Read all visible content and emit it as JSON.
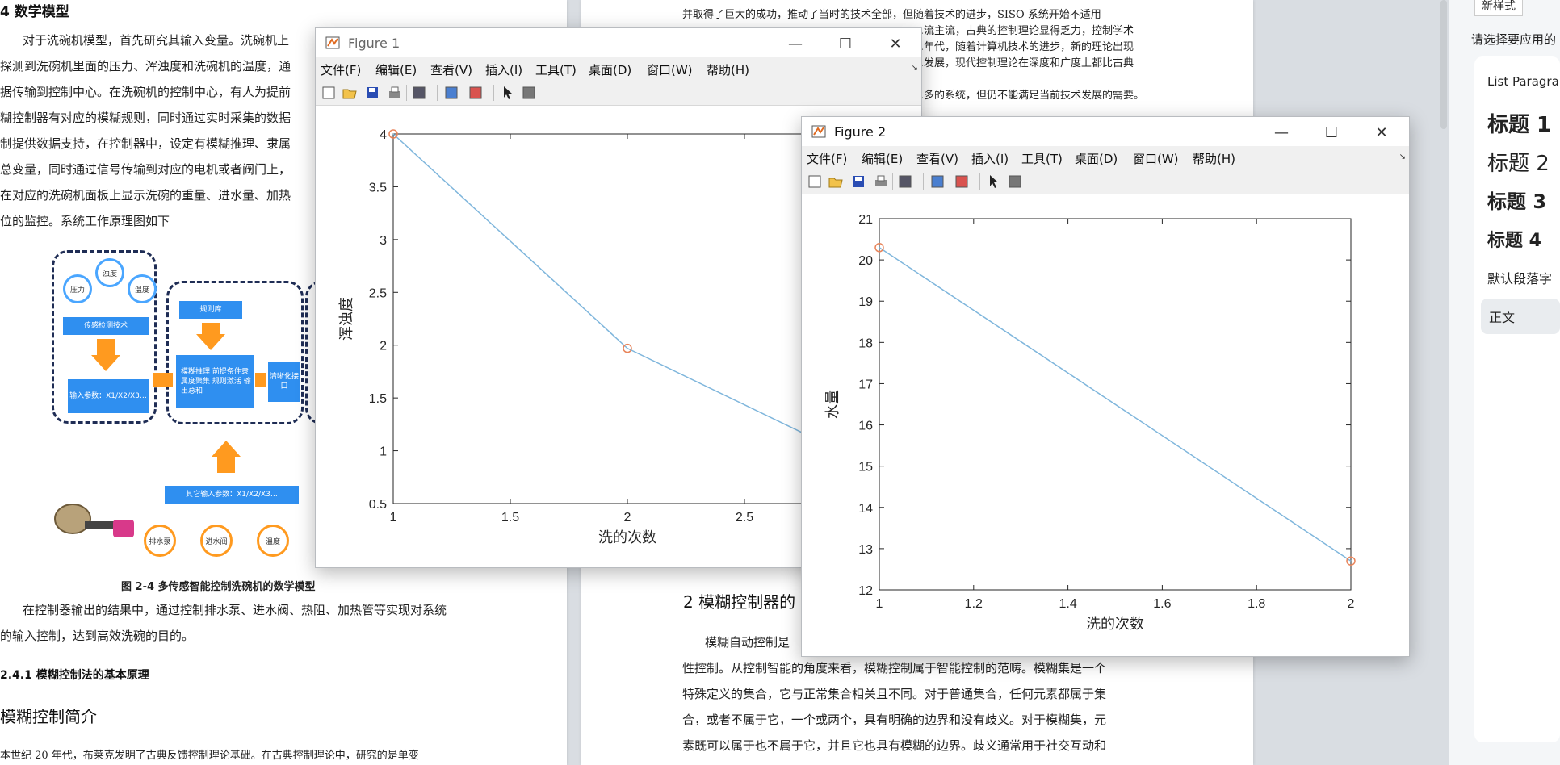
{
  "document": {
    "left_heading": "4 数学模型",
    "left_paragraph_lines": [
      "对于洗碗机模型，首先研究其输入变量。洗碗机上",
      "探测到洗碗机里面的压力、浑浊度和洗碗机的温度，通",
      "据传输到控制中心。在洗碗机的控制中心，有人为提前",
      "糊控制器有对应的模糊规则，同时通过实时采集的数据",
      "制提供数据支持，在控制器中，设定有模糊推理、隶属",
      "总变量，同时通过信号传输到对应的电机或者阀门上，",
      "在对应的洗碗机面板上显示洗碗的重量、进水量、加热",
      "位的监控。系统工作原理图如下"
    ],
    "diagram_labels": {
      "pressure": "压力",
      "turbidity": "浊度",
      "temperature": "温度",
      "sensor": "传感检测技术",
      "inputs": "输入参数：X1/X2/X3…",
      "rule_base": "规则库",
      "inference": "模糊推理 前提条件隶属度聚集 规则激活 输出总和",
      "defuzz": "清晰化接口",
      "other_inputs": "其它输入参数：X1/X2/X3…",
      "drain_pump": "排水泵",
      "inlet_valve": "进水阀",
      "temp2": "温度"
    },
    "figure_caption": "图 2-4  多传感智能控制洗碗机的数学模型",
    "after_caption_lines": [
      "在控制器输出的结果中，通过控制排水泵、进水阀、热阻、加热管等实现对系统",
      "的输入控制，达到高效洗碗的目的。"
    ],
    "subsection": "2.4.1  模糊控制法的基本原理",
    "subsection2": "模糊控制简介",
    "bottom_line": "本世纪 20 年代，布莱克发明了古典反馈控制理论基础。在古典控制理论中，研究的是单变",
    "right_top_lines": [
      "并取得了巨大的成功，推动了当时的技术全部，但随着技术的进步，SISO 系统开始不适用",
      "……………………………………………………………流主流，古典的控制理论显得乏力，控制学术",
      "……………………………………………………………年代，随着计算机技术的进步，新的理论出现",
      "……………………………………………………………发展，现代控制理论在深度和广度上都比古典",
      "",
      "……………………………………………………………多的系统，但仍不能满足当前技术发展的需要。"
    ],
    "right_section": "2 模糊控制器的",
    "right_para_lines": [
      "模糊自动控制是",
      "性控制。从控制智能的角度来看，模糊控制属于智能控制的范畴。模糊集是一个",
      "特殊定义的集合，它与正常集合相关且不同。对于普通集合，任何元素都属于集",
      "合，或者不属于它，一个或两个，具有明确的边界和没有歧义。对于模糊集，元",
      "素既可以属于也不属于它，并且它也具有模糊的边界。歧义通常用于社交互动和"
    ]
  },
  "side_panel": {
    "tab1": "新样式",
    "prompt": "请选择要应用的",
    "list_title": "List Paragrap",
    "styles": [
      "标题 1",
      "标题 2",
      "标题 3",
      "标题 4"
    ],
    "default_text": "默认段落字",
    "body_style": "正文"
  },
  "figure1": {
    "title": "Figure 1",
    "menu": [
      "文件(F)",
      "编辑(E)",
      "查看(V)",
      "插入(I)",
      "工具(T)",
      "桌面(D)",
      "窗口(W)",
      "帮助(H)"
    ],
    "controls": {
      "minimize": "—",
      "maximize": "☐",
      "close": "✕"
    },
    "icon": "matlab-figure-icon"
  },
  "figure2": {
    "title": "Figure 2",
    "menu": [
      "文件(F)",
      "编辑(E)",
      "查看(V)",
      "插入(I)",
      "工具(T)",
      "桌面(D)",
      "窗口(W)",
      "帮助(H)"
    ],
    "controls": {
      "minimize": "—",
      "maximize": "☐",
      "close": "✕"
    },
    "icon": "matlab-figure-icon"
  },
  "toolbar_icons": [
    "new-figure-icon",
    "open-file-icon",
    "save-icon",
    "print-icon",
    "print-preview-icon",
    "link-plot-icon",
    "insert-legend-icon",
    "pointer-icon",
    "property-editor-icon"
  ],
  "chart_data": [
    {
      "type": "line",
      "figure": "Figure 1",
      "x": [
        1,
        2,
        3
      ],
      "y": [
        4,
        1.97,
        0.9
      ],
      "xlabel": "洗的次数",
      "ylabel": "浑浊度",
      "xlim": [
        1,
        3
      ],
      "ylim": [
        0.5,
        4
      ],
      "xticks": [
        "1",
        "1.5",
        "2",
        "2.5"
      ],
      "yticks": [
        "0.5",
        "1",
        "1.5",
        "2",
        "2.5",
        "3",
        "3.5",
        "4"
      ],
      "line_color": "#7fb6dc",
      "marker_color": "#e8845a",
      "grid": false
    },
    {
      "type": "line",
      "figure": "Figure 2",
      "x": [
        1,
        2
      ],
      "y": [
        20.3,
        12.7
      ],
      "xlabel": "洗的次数",
      "ylabel": "水量",
      "xlim": [
        1,
        2
      ],
      "ylim": [
        12,
        21
      ],
      "xticks": [
        "1",
        "1.2",
        "1.4",
        "1.6",
        "1.8",
        "2"
      ],
      "yticks": [
        "12",
        "13",
        "14",
        "15",
        "16",
        "17",
        "18",
        "19",
        "20",
        "21"
      ],
      "line_color": "#7fb6dc",
      "marker_color": "#e8845a",
      "grid": false
    }
  ]
}
